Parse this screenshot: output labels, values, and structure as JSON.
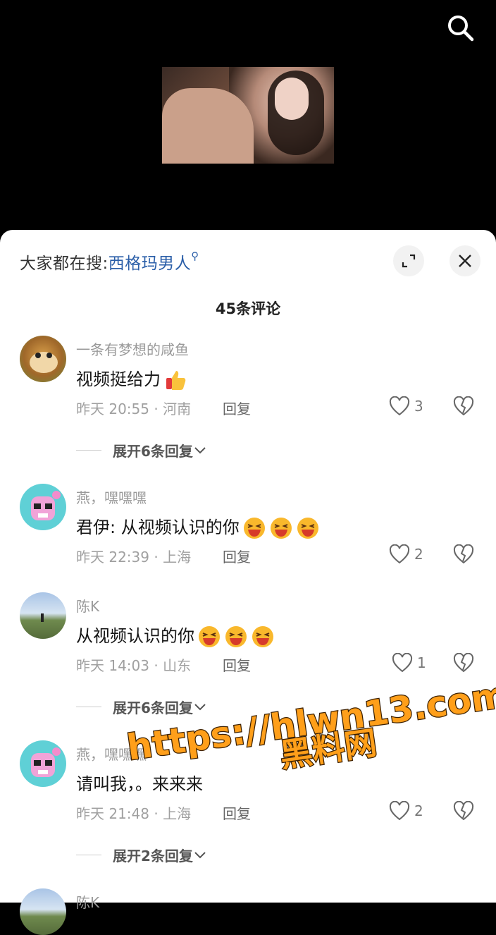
{
  "header": {
    "search_icon": "search-icon"
  },
  "panel": {
    "hint_prefix": "大家都在搜:",
    "hint_keyword": "西格玛男人",
    "count_label": "45条评论"
  },
  "comments": [
    {
      "username": "一条有梦想的咸鱼",
      "text": "视频挺给力",
      "emoji": "thumbs-up",
      "time": "昨天 20:55 · 河南",
      "reply": "回复",
      "likes": "3",
      "expand": "展开6条回复"
    },
    {
      "username": "燕，嘿嘿嘿",
      "text": "君伊: 从视频认识的你",
      "emoji": "laughing",
      "time": "昨天 22:39 · 上海",
      "reply": "回复",
      "likes": "2"
    },
    {
      "username": "陈K",
      "text": "从视频认识的你",
      "emoji": "laughing",
      "time": "昨天 14:03 · 山东",
      "reply": "回复",
      "likes": "1",
      "expand": "展开6条回复"
    },
    {
      "username": "燕，嘿嘿嘿",
      "text": "请叫我，。来来来",
      "time": "昨天 21:48 · 上海",
      "reply": "回复",
      "likes": "2",
      "expand": "展开2条回复"
    },
    {
      "username": "陈K"
    }
  ],
  "watermark": {
    "line1": "https://hlwn13.com",
    "line2": "黑料网"
  },
  "colors": {
    "link": "#2a5ea8",
    "watermark_fill": "#ff9f1a"
  }
}
